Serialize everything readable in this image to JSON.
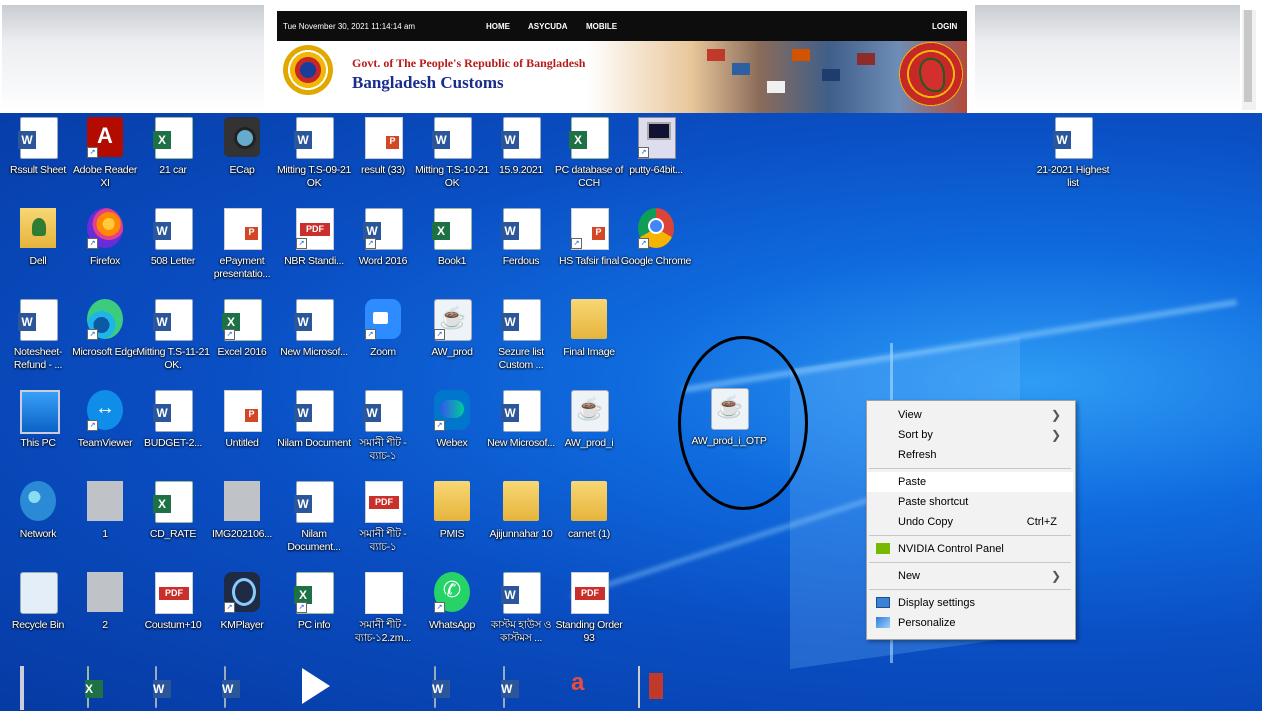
{
  "website": {
    "datetime": "Tue November 30, 2021 11:14:14 am",
    "nav": [
      "HOME",
      "ASYCUDA",
      "MOBILE"
    ],
    "login": "LOGIN",
    "gov_title": "Govt. of The People's Republic of Bangladesh",
    "org_title": "Bangladesh Customs"
  },
  "desktop": {
    "icons": [
      {
        "label": "Rssult Sheet",
        "icon": "word-doc-icon"
      },
      {
        "label": "Adobe Reader XI",
        "icon": "adobe-reader-icon"
      },
      {
        "label": "21 car",
        "icon": "excel-doc-icon"
      },
      {
        "label": "ECap",
        "icon": "camera-icon"
      },
      {
        "label": "Mitting T.S-09-21 OK",
        "icon": "word-doc-icon"
      },
      {
        "label": "result (33)",
        "icon": "image-file-icon"
      },
      {
        "label": "Mitting T.S-10-21 OK",
        "icon": "word-doc-icon"
      },
      {
        "label": "15.9.2021",
        "icon": "word-doc-icon"
      },
      {
        "label": "PC database of CCH",
        "icon": "excel-doc-icon"
      },
      {
        "label": "putty-64bit...",
        "icon": "putty-icon"
      },
      {
        "label": "21-2021 Highest list",
        "icon": "word-doc-icon"
      },
      {
        "label": "Dell",
        "icon": "folder-user-icon"
      },
      {
        "label": "Firefox",
        "icon": "firefox-icon"
      },
      {
        "label": "508 Letter",
        "icon": "word-doc-icon"
      },
      {
        "label": "ePayment presentatio...",
        "icon": "powerpoint-icon"
      },
      {
        "label": "NBR Standi...",
        "icon": "pdf-icon"
      },
      {
        "label": "Word 2016",
        "icon": "word-app-icon"
      },
      {
        "label": "Book1",
        "icon": "excel-doc-icon"
      },
      {
        "label": "Ferdous",
        "icon": "word-doc-icon"
      },
      {
        "label": "HS Tafsir final",
        "icon": "powerpoint-icon"
      },
      {
        "label": "Google Chrome",
        "icon": "chrome-icon"
      },
      {
        "label": "Notesheet-Refund - ...",
        "icon": "word-doc-icon"
      },
      {
        "label": "Microsoft Edge",
        "icon": "edge-icon"
      },
      {
        "label": "Mitting T.S-11-21 OK.",
        "icon": "word-doc-icon"
      },
      {
        "label": "Excel 2016",
        "icon": "excel-app-icon"
      },
      {
        "label": "New Microsof...",
        "icon": "word-doc-icon"
      },
      {
        "label": "Zoom",
        "icon": "zoom-icon"
      },
      {
        "label": "AW_prod",
        "icon": "java-icon"
      },
      {
        "label": "Sezure list Custom ...",
        "icon": "word-doc-icon"
      },
      {
        "label": "Final Image",
        "icon": "folder-icon"
      },
      {
        "label": "This PC",
        "icon": "this-pc-icon"
      },
      {
        "label": "TeamViewer",
        "icon": "teamviewer-icon"
      },
      {
        "label": "BUDGET-2...",
        "icon": "word-doc-icon"
      },
      {
        "label": "Untitled",
        "icon": "image-file-icon"
      },
      {
        "label": "Nilam Document",
        "icon": "word-doc-icon"
      },
      {
        "label": "সমানী শীট - ব্যাচ-১",
        "icon": "word-doc-icon"
      },
      {
        "label": "Webex",
        "icon": "webex-icon"
      },
      {
        "label": "New Microsof...",
        "icon": "word-doc-icon"
      },
      {
        "label": "AW_prod_i",
        "icon": "java-icon"
      },
      {
        "label": "AW_prod_i_OTP",
        "icon": "java-icon"
      },
      {
        "label": "Network",
        "icon": "network-icon"
      },
      {
        "label": "1",
        "icon": "document-scan-icon"
      },
      {
        "label": "CD_RATE",
        "icon": "excel-doc-icon"
      },
      {
        "label": "IMG202106...",
        "icon": "document-scan-icon"
      },
      {
        "label": "Nilam Document...",
        "icon": "word-doc-icon"
      },
      {
        "label": "সমানী শীট - ব্যাচ-১",
        "icon": "pdf-icon"
      },
      {
        "label": "PMIS",
        "icon": "folder-icon"
      },
      {
        "label": "Ajijunnahar 10",
        "icon": "folder-icon"
      },
      {
        "label": "carnet (1)",
        "icon": "folder-icon"
      },
      {
        "label": "Recycle Bin",
        "icon": "recycle-bin-icon"
      },
      {
        "label": "2",
        "icon": "document-scan-icon"
      },
      {
        "label": "Coustum+10",
        "icon": "pdf-icon"
      },
      {
        "label": "KMPlayer",
        "icon": "kmplayer-icon"
      },
      {
        "label": "PC info",
        "icon": "excel-app-icon"
      },
      {
        "label": "সমানী শীট - ব্যাচ-১2.zm...",
        "icon": "blank-file-icon"
      },
      {
        "label": "WhatsApp",
        "icon": "whatsapp-icon"
      },
      {
        "label": "কাস্টম হাউস ও কাস্টমস ...",
        "icon": "word-doc-icon"
      },
      {
        "label": "Standing Order 93",
        "icon": "pdf-icon"
      }
    ],
    "bottom_icons": [
      "control-panel-icon",
      "excel-doc-icon",
      "word-doc-icon",
      "word-doc-icon",
      "media-play-icon",
      "document-scan-icon",
      "word-doc-icon",
      "word-doc-icon",
      "aw-app-icon",
      "book-icon"
    ]
  },
  "context_menu": {
    "items": [
      {
        "label": "View",
        "submenu": true
      },
      {
        "label": "Sort by",
        "submenu": true
      },
      {
        "label": "Refresh"
      },
      {
        "label": "Paste",
        "highlighted": true
      },
      {
        "label": "Paste shortcut"
      },
      {
        "label": "Undo Copy",
        "shortcut": "Ctrl+Z"
      },
      {
        "label": "NVIDIA Control Panel",
        "icon": "nvidia-icon"
      },
      {
        "label": "New",
        "submenu": true
      },
      {
        "label": "Display settings",
        "icon": "display-icon"
      },
      {
        "label": "Personalize",
        "icon": "personalize-icon"
      }
    ]
  },
  "colors": {
    "desktop_blue": "#0a4fc4",
    "menu_bg": "#f2f2f2",
    "nav_bg": "#0d0d0d",
    "gov_red": "#b71c1c",
    "customs_blue": "#1a2d8a"
  }
}
